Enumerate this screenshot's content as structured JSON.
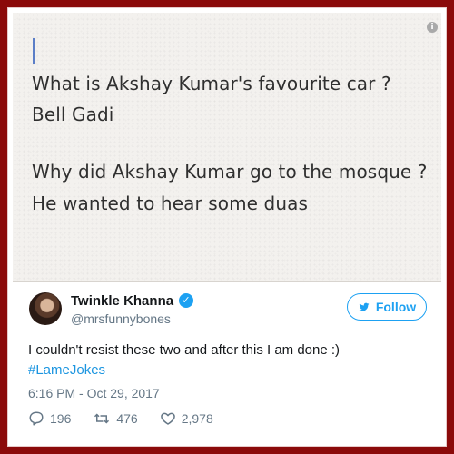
{
  "note": {
    "line1": "What is Akshay Kumar's favourite car ?",
    "line2": "Bell Gadi",
    "line3": "Why did Akshay Kumar go to the mosque ?",
    "line4": "He wanted to hear some duas",
    "info_icon": "info-icon"
  },
  "tweet": {
    "author_name": "Twinkle Khanna",
    "verified_icon": "verified-badge-icon",
    "handle": "@mrsfunnybones",
    "follow_label": "Follow",
    "text": "I couldn't resist these two and after this I am done :)",
    "hashtag": "#LameJokes",
    "timestamp": "6:16 PM - Oct 29, 2017",
    "replies": "196",
    "retweets": "476",
    "likes": "2,978"
  },
  "colors": {
    "frame": "#8b0a0a",
    "twitter_blue": "#1da1f2",
    "hashtag": "#1b95e0",
    "meta_gray": "#657786"
  }
}
